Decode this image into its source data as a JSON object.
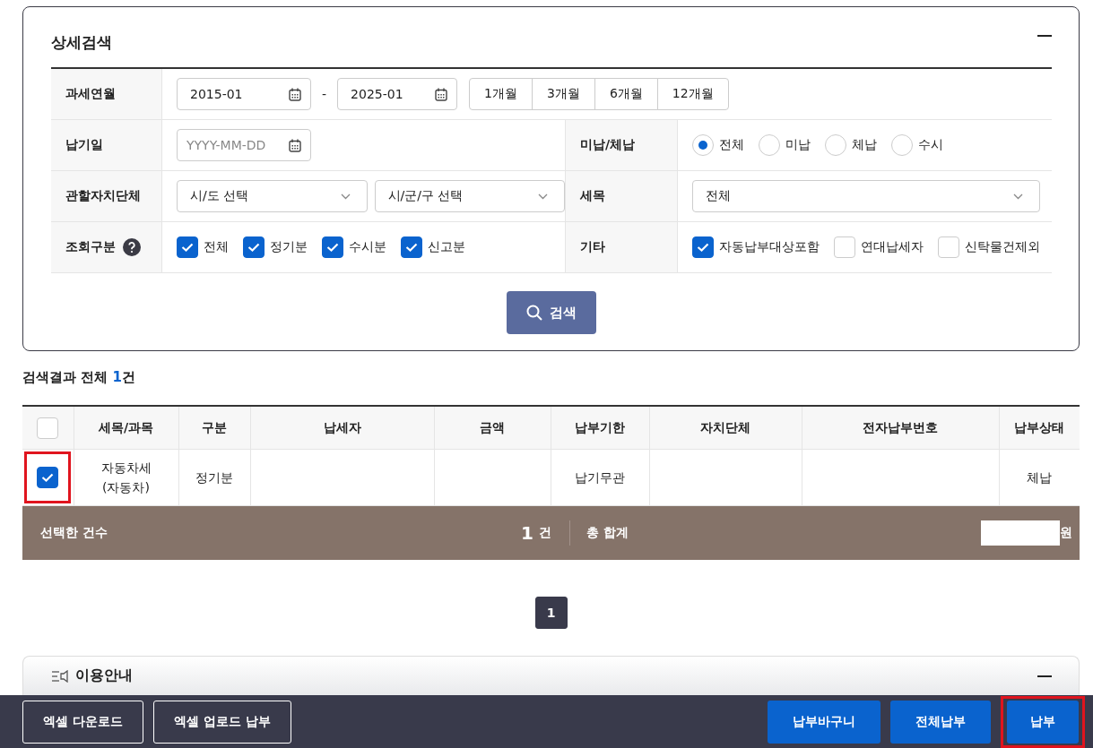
{
  "search": {
    "title": "상세검색",
    "expanded": true,
    "tax_period": {
      "label": "과세연월",
      "from": "2015-01",
      "separator": "-",
      "to": "2025-01",
      "ranges": [
        "1개월",
        "3개월",
        "6개월",
        "12개월"
      ]
    },
    "due_date": {
      "label": "납기일",
      "placeholder": "YYYY-MM-DD"
    },
    "payment_status": {
      "label": "미납/체납",
      "options": [
        {
          "label": "전체",
          "selected": true
        },
        {
          "label": "미납",
          "selected": false
        },
        {
          "label": "체납",
          "selected": false
        },
        {
          "label": "수시",
          "selected": false
        }
      ]
    },
    "authority": {
      "label": "관할자치단체",
      "selects": [
        "시/도 선택",
        "시/군/구 선택"
      ]
    },
    "tax_item": {
      "label": "세목",
      "value": "전체"
    },
    "query_type": {
      "label": "조회구분",
      "options": [
        {
          "label": "전체",
          "checked": true
        },
        {
          "label": "정기분",
          "checked": true
        },
        {
          "label": "수시분",
          "checked": true
        },
        {
          "label": "신고분",
          "checked": true
        }
      ]
    },
    "other": {
      "label": "기타",
      "options": [
        {
          "label": "자동납부대상포함",
          "checked": true
        },
        {
          "label": "연대납세자",
          "checked": false
        },
        {
          "label": "신탁물건제외",
          "checked": false
        }
      ]
    },
    "search_button": "검색"
  },
  "results": {
    "title": "검색결과 전체",
    "count": "1",
    "unit": "건",
    "columns": [
      "세목/과목",
      "구분",
      "납세자",
      "금액",
      "납부기한",
      "자치단체",
      "전자납부번호",
      "납부상태"
    ],
    "all_checked": false,
    "rows": [
      {
        "checked": true,
        "highlighted": true,
        "tax_item": [
          "자동차세",
          "(자동차)"
        ],
        "category": "정기분",
        "due": "납기무관",
        "status": "체납"
      }
    ],
    "summary": {
      "selected_label": "선택한 건수",
      "selected_count": "1",
      "count_unit": "건",
      "total_label": "총 합계",
      "total_unit": "원"
    }
  },
  "pagination": [
    {
      "label": "1",
      "selected": true
    }
  ],
  "info": {
    "title": "이용안내",
    "expanded": true
  },
  "footer": {
    "buttons": [
      {
        "label": "엑셀 다운로드",
        "kind": "outline",
        "highlighted": false
      },
      {
        "label": "엑셀 업로드 납부",
        "kind": "outline",
        "highlighted": false
      },
      {
        "label": "납부바구니",
        "kind": "primary",
        "highlighted": false
      },
      {
        "label": "전체납부",
        "kind": "primary",
        "highlighted": false
      },
      {
        "label": "납부",
        "kind": "primary",
        "highlighted": true
      }
    ]
  }
}
